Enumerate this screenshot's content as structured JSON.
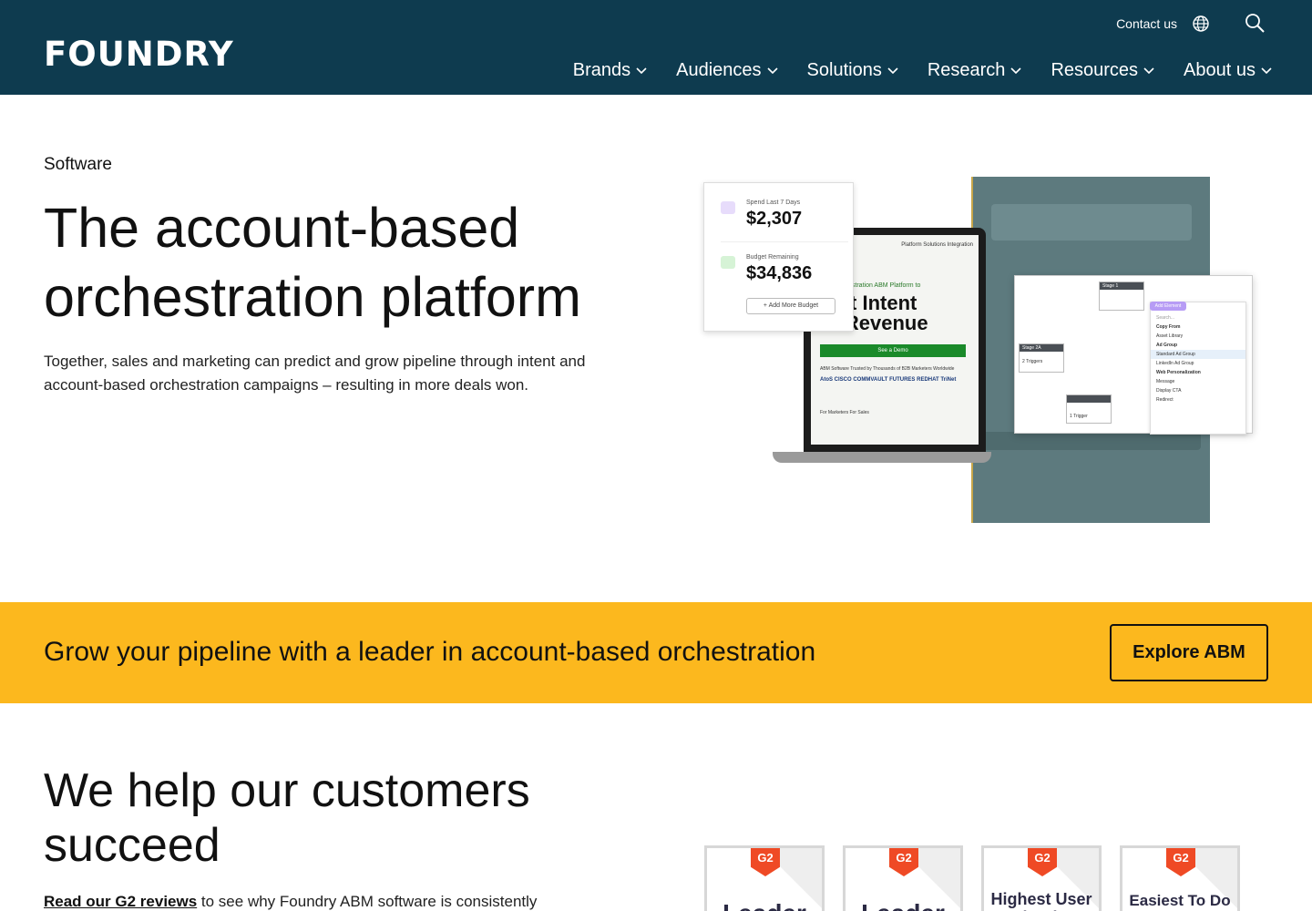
{
  "header": {
    "logo": "FOUNDRY",
    "contact": "Contact us",
    "nav": [
      "Brands",
      "Audiences",
      "Solutions",
      "Research",
      "Resources",
      "About us"
    ]
  },
  "hero": {
    "eyebrow": "Software",
    "title": "The account-based orchestration platform",
    "description": "Together, sales and marketing can predict and grow pipeline through intent and account-based orchestration campaigns – resulting in more deals won.",
    "art": {
      "spend_label": "Spend Last 7 Days",
      "spend_value": "$2,307",
      "budget_label": "Budget Remaining",
      "budget_value": "$34,836",
      "add_budget": "+ Add More Budget",
      "screen_nav": "Platform   Solutions   Integration",
      "screen_sub": "e Orchestration ABM Platform to",
      "screen_big": "vert Intent\nto Revenue",
      "screen_btn": "See a Demo",
      "screen_trusted": "ABM Software Trusted by Thousands of B2B Marketers Worldwide",
      "screen_logos": "AtoS  CISCO  COMMVAULT  FUTURES  REDHAT  TriNet",
      "screen_links": "For Marketers    For Sales",
      "stage1": "Stage 1",
      "stage2a": "Stage 2A",
      "triggers2": "2 Triggers",
      "trigger1": "1 Trigger",
      "add_element": "Add Element",
      "dd_search": "Search...",
      "dd_items": [
        "Copy From",
        "Asset Library",
        "Ad Group",
        "Standard Ad Group",
        "LinkedIn Ad Group",
        "Web Personalization",
        "Message",
        "Display CTA",
        "Redirect"
      ]
    }
  },
  "band": {
    "text": "Grow your pipeline with a leader in account-based orchestration",
    "button": "Explore ABM"
  },
  "customers": {
    "title": "We help our customers succeed",
    "link": "Read our G2 reviews",
    "rest": " to see why Foundry ABM software is consistently",
    "badges": [
      "Leader",
      "Leader",
      "Highest User Adoption",
      "Easiest To Do Business With"
    ]
  }
}
